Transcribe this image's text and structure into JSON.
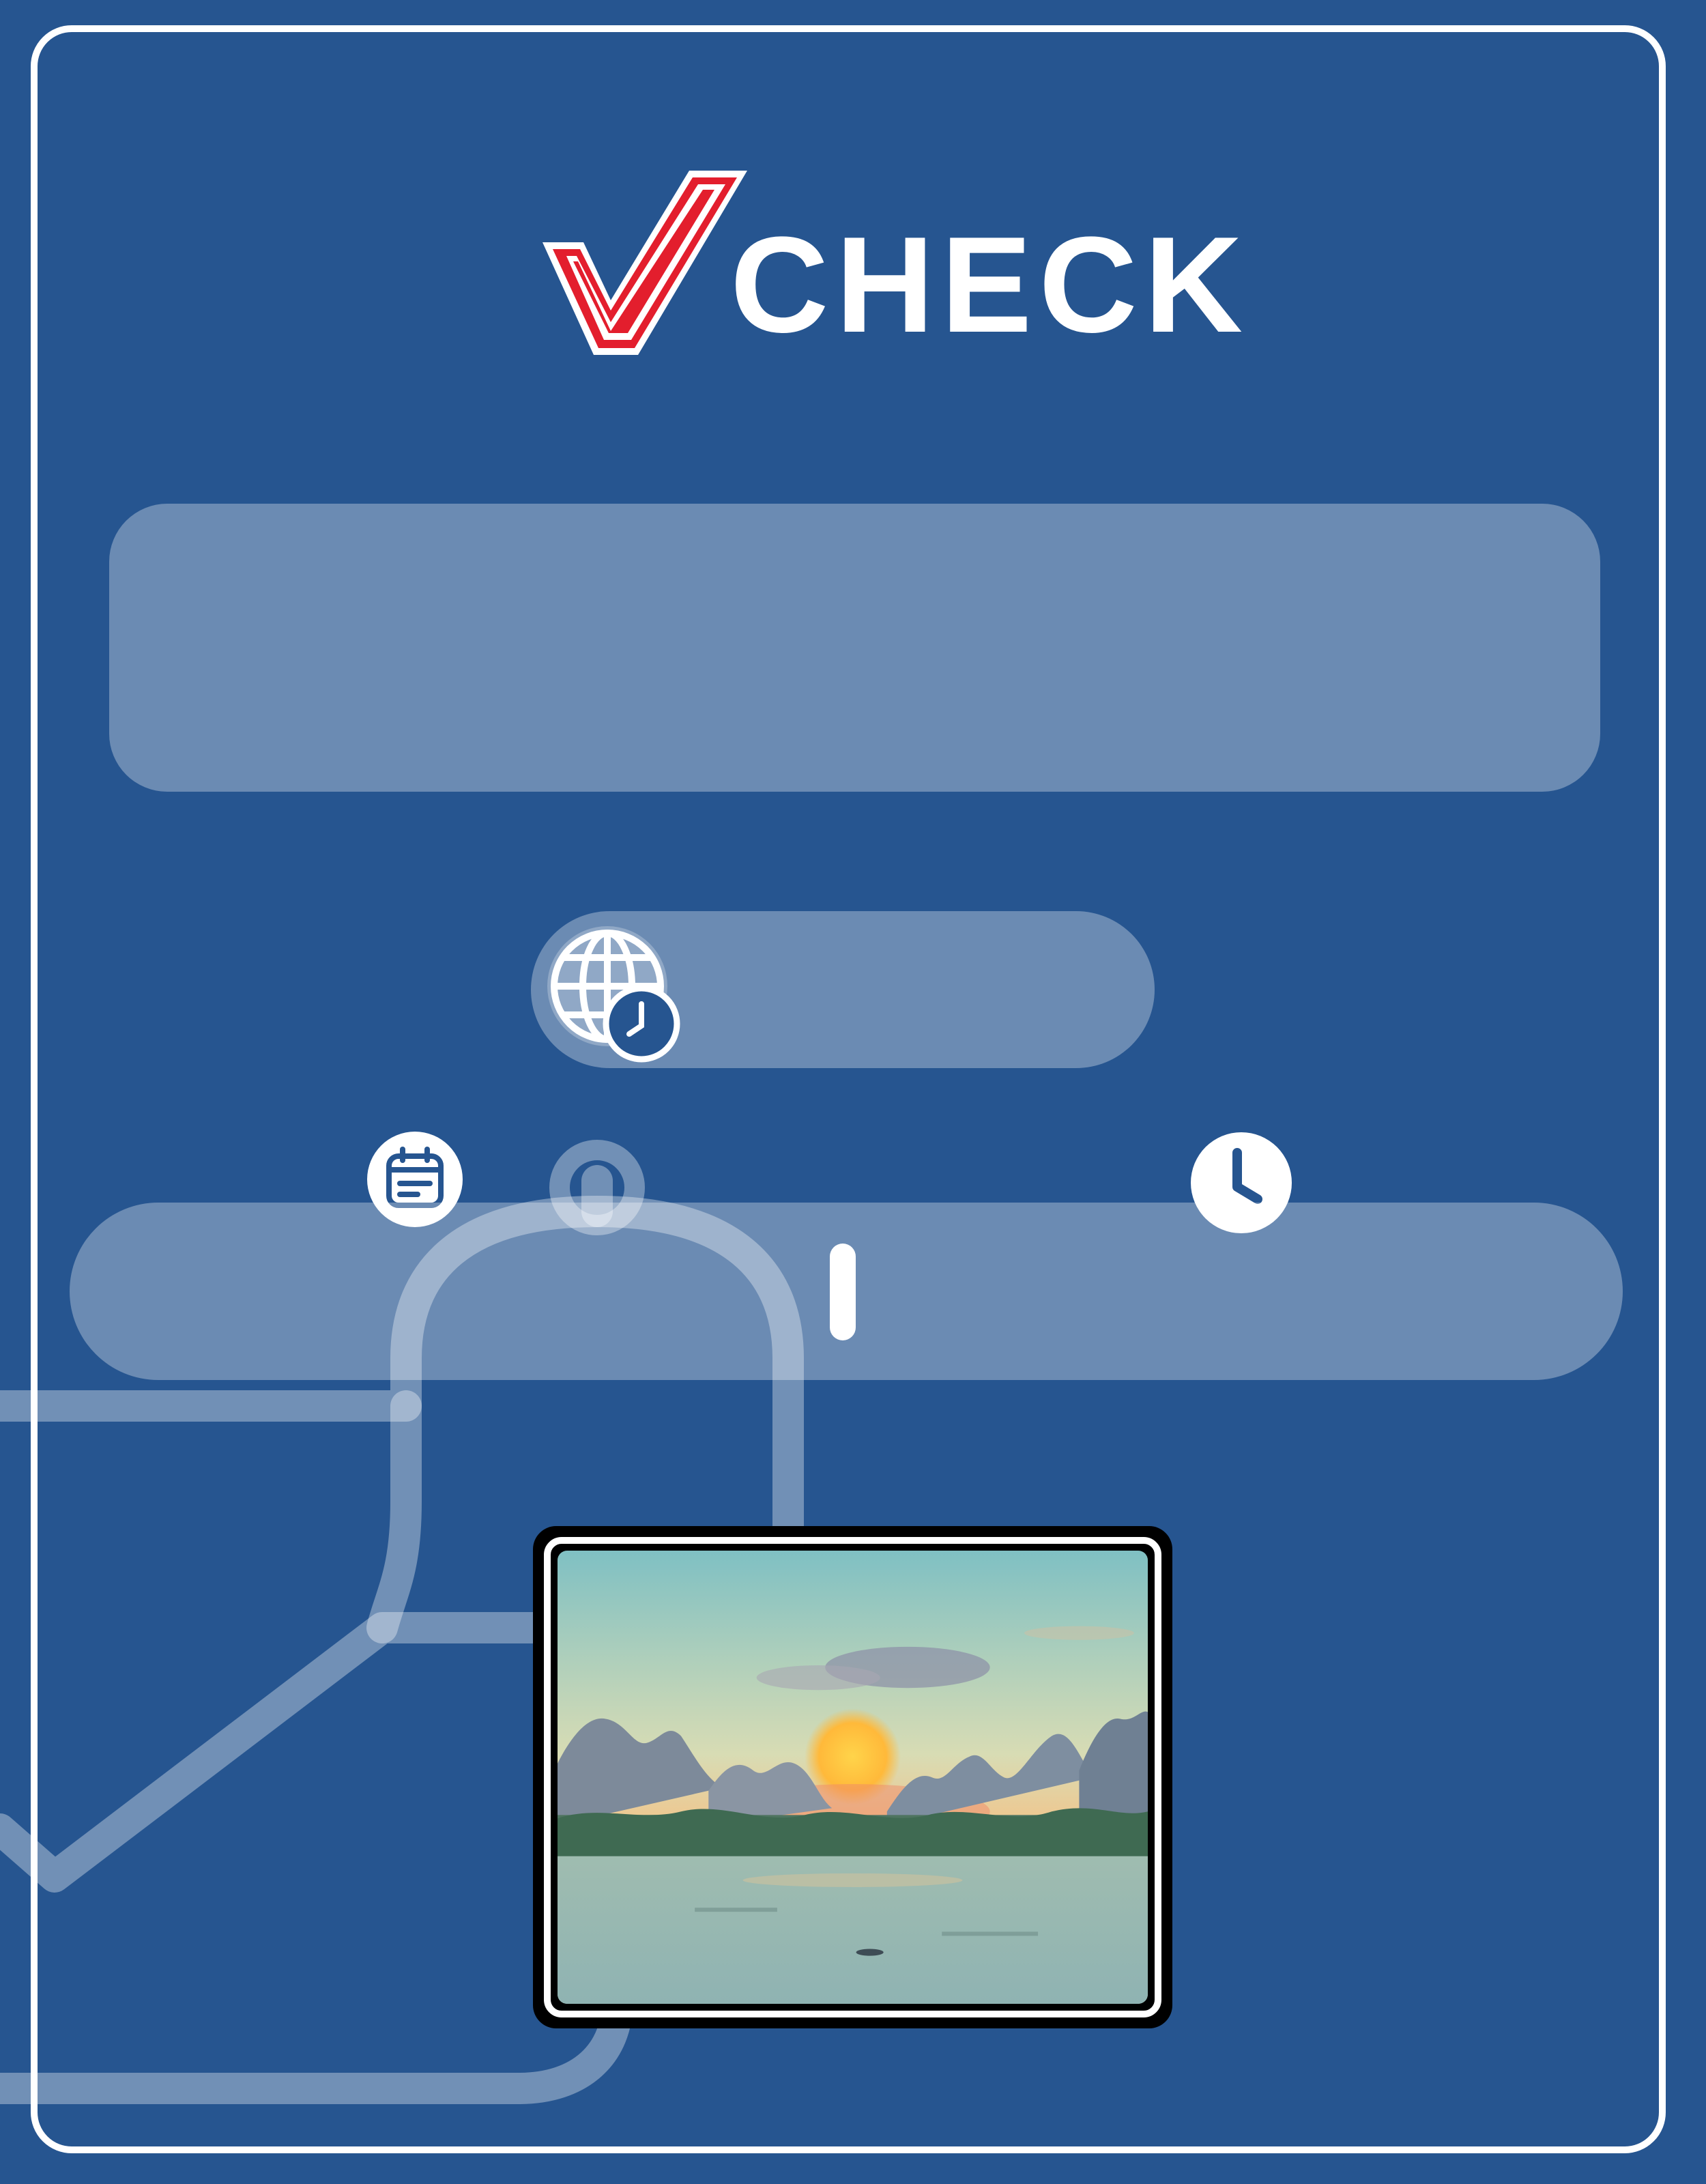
{
  "logo": {
    "text": "CHECK",
    "mark": "V"
  },
  "info_panel": {
    "text": ""
  },
  "timezone": {
    "icon": "globe-clock-icon",
    "value": ""
  },
  "datetime": {
    "date_icon": "calendar-icon",
    "time_icon": "clock-icon",
    "date": "",
    "time": ""
  },
  "photo": {
    "description_icon": "landscape-photo"
  },
  "colors": {
    "background": "#265590",
    "accent": "#e31e2d",
    "panel": "rgba(255,255,255,0.32)"
  }
}
